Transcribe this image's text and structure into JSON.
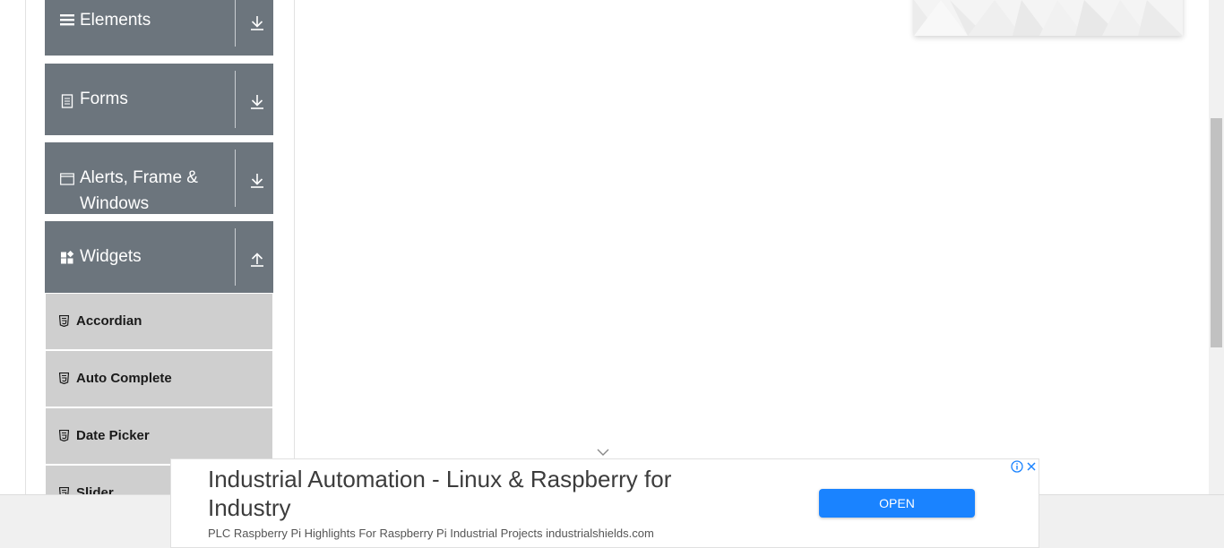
{
  "sidebar": {
    "groups": [
      {
        "label": "Elements",
        "icon": "hamburger-icon",
        "toggle": "download-arrow-icon"
      },
      {
        "label": "Forms",
        "icon": "document-icon",
        "toggle": "download-arrow-icon"
      },
      {
        "label": "Alerts, Frame & Windows",
        "icon": "window-icon",
        "toggle": "download-arrow-icon"
      },
      {
        "label": "Widgets",
        "icon": "widgets-icon",
        "toggle": "upload-arrow-icon"
      }
    ],
    "widget_items": [
      {
        "label": "Accordian",
        "icon": "html5-icon"
      },
      {
        "label": "Auto Complete",
        "icon": "html5-icon"
      },
      {
        "label": "Date Picker",
        "icon": "html5-icon"
      },
      {
        "label": "Slider",
        "icon": "html5-icon"
      }
    ]
  },
  "ad": {
    "headline": "Industrial Automation - Linux & Raspberry for Industry",
    "description": "PLC Raspberry Pi Highlights For Raspberry Pi Industrial Projects industrialshields.com",
    "button_label": "OPEN",
    "button_color": "#1a83ff"
  },
  "colors": {
    "group_bg": "#6c757d",
    "item_bg": "#cfcfcf"
  }
}
